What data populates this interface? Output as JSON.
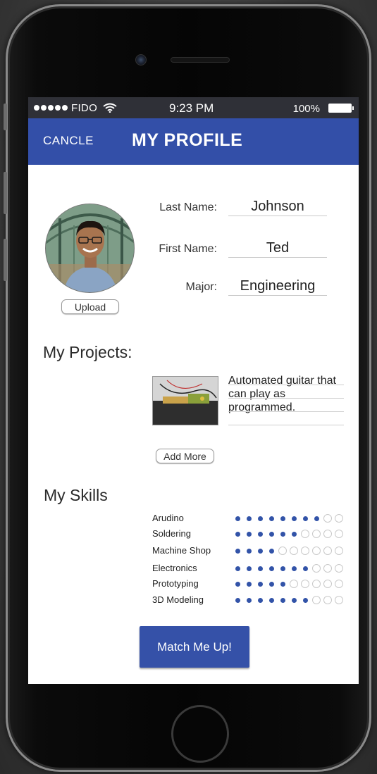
{
  "status_bar": {
    "carrier": "FIDO",
    "time": "9:23 PM",
    "battery_percent": "100%"
  },
  "navbar": {
    "cancel_label": "CANCLE",
    "title": "MY PROFILE",
    "accent_color": "#334fa8"
  },
  "profile": {
    "upload_label": "Upload",
    "fields": {
      "last_name": {
        "label": "Last Name:",
        "value": "Johnson"
      },
      "first_name": {
        "label": "First Name:",
        "value": "Ted"
      },
      "major": {
        "label": "Major:",
        "value": "Engineering"
      }
    }
  },
  "projects": {
    "title": "My Projects:",
    "items": [
      {
        "description": "Automated guitar that can play as programmed."
      }
    ],
    "add_more_label": "Add More"
  },
  "skills": {
    "title": "My Skills",
    "max_level": 10,
    "items": [
      {
        "name": "Arudino",
        "level": 8
      },
      {
        "name": "Soldering",
        "level": 6
      },
      {
        "name": "Machine Shop",
        "level": 4
      },
      {
        "name": "Electronics",
        "level": 7
      },
      {
        "name": "Prototyping",
        "level": 5
      },
      {
        "name": "3D Modeling",
        "level": 7
      }
    ]
  },
  "match_button_label": "Match Me Up!"
}
